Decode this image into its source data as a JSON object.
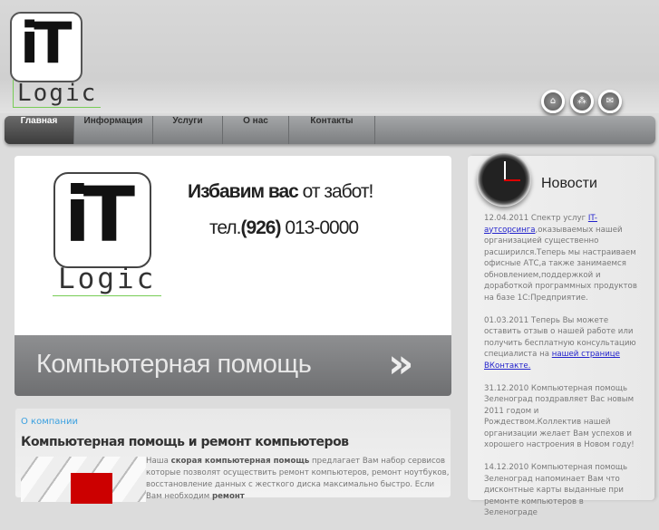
{
  "header": {
    "logo_text": "iT",
    "logo_word": "Logic",
    "icons": [
      "home-icon",
      "sitemap-icon",
      "mail-icon"
    ]
  },
  "nav": {
    "items": [
      {
        "label": "Главная",
        "active": true
      },
      {
        "label": "Информация"
      },
      {
        "label": "Услуги"
      },
      {
        "label": "О нас"
      },
      {
        "label": "Контакты"
      }
    ]
  },
  "banner": {
    "logo_text": "iT",
    "logo_word": "Logic",
    "slogan_bold": "Избавим вас",
    "slogan_rest": " от забот!",
    "phone_prefix": "тел.",
    "phone_code": "(926)",
    "phone_number": " 013-0000",
    "band_title": "Компьютерная помощь",
    "band_arrow": "»"
  },
  "content": {
    "breadcrumb": "О компании",
    "title": "Компьютерная помощь и ремонт компьютеров",
    "text_1": "Наша ",
    "text_bold_1": "скорая компьютерная помощь",
    "text_2": " предлагает Вам набор сервисов которые позволят осуществить ремонт компьютеров, ремонт ноутбуков, восстановление данных с жесткого диска максимально быстро. Если Вам необходим ",
    "text_bold_2": "ремонт"
  },
  "sidebar": {
    "title": "Новости",
    "news": [
      {
        "text": "12.04.2011 Спектр услуг ",
        "link": "IT-аутсорсинга",
        "after": ",оказываемых нашей организацией существенно расширился.Теперь мы настраиваем офисные АТС,а также занимаемся обновлением,поддержкой и доработкой программных продуктов на базе 1С:Предприятие."
      },
      {
        "text": "01.03.2011 Теперь Вы можете оставить отзыв о нашей работе или получить бесплатную консультацию специалиста на ",
        "link": "нашей странице ВКонтакте.",
        "after": ""
      },
      {
        "text": "31.12.2010 Компьютерная помощь Зеленоград поздравляет Вас новым 2011 годом и Рождеством.Коллектив нашей организации желает Вам успехов и хорошего настроения в Новом году!",
        "link": "",
        "after": ""
      },
      {
        "text": "14.12.2010 Компьютерная помощь Зеленоград напоминает Вам что дисконтные карты выданные при ремонте компьютеров в Зеленограде",
        "link": "",
        "after": ""
      }
    ]
  }
}
